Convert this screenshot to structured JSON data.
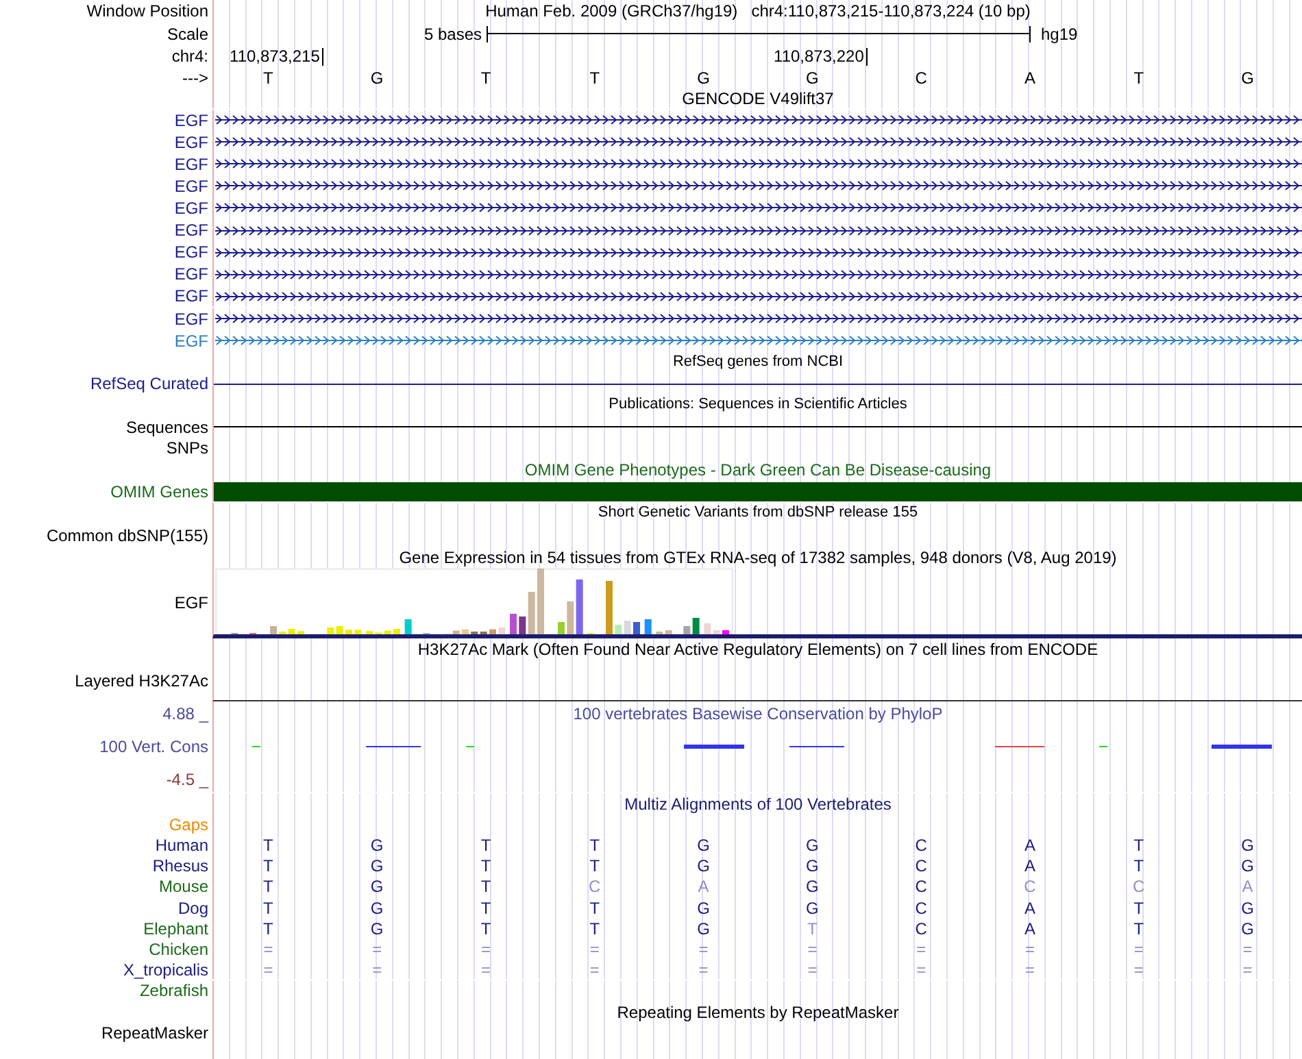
{
  "header": {
    "label": "Window Position",
    "assembly": "Human Feb. 2009 (GRCh37/hg19)",
    "position": "chr4:110,873,215-110,873,224 (10 bp)"
  },
  "scale": {
    "label": "Scale",
    "length": "5 bases",
    "assembly": "hg19"
  },
  "ruler": {
    "label": "chr4:",
    "ticks": [
      "110,873,215",
      "110,873,220"
    ]
  },
  "bases": {
    "label": "--->",
    "letters": [
      "T",
      "G",
      "T",
      "T",
      "G",
      "G",
      "C",
      "A",
      "T",
      "G"
    ]
  },
  "gencode": {
    "title": "GENCODE V49lift37",
    "transcripts": [
      {
        "label": "EGF",
        "color": "#1c1c8c"
      },
      {
        "label": "EGF",
        "color": "#1c1c8c"
      },
      {
        "label": "EGF",
        "color": "#1c1c8c"
      },
      {
        "label": "EGF",
        "color": "#1c1c8c"
      },
      {
        "label": "EGF",
        "color": "#1c1c8c"
      },
      {
        "label": "EGF",
        "color": "#1c1c8c"
      },
      {
        "label": "EGF",
        "color": "#1c1c8c"
      },
      {
        "label": "EGF",
        "color": "#1c1c8c"
      },
      {
        "label": "EGF",
        "color": "#1c1c8c"
      },
      {
        "label": "EGF",
        "color": "#1c1c8c"
      },
      {
        "label": "EGF",
        "color": "#2a7fc0"
      }
    ]
  },
  "refseq": {
    "title": "RefSeq genes from NCBI",
    "label": "RefSeq Curated"
  },
  "publications": {
    "title": "Publications: Sequences in Scientific Articles",
    "label": "Sequences"
  },
  "snps": {
    "label": "SNPs"
  },
  "omim": {
    "title": "OMIM Gene Phenotypes - Dark Green Can Be Disease-causing",
    "label": "OMIM Genes"
  },
  "dbsnp": {
    "title": "Short Genetic Variants from dbSNP release 155",
    "label": "Common dbSNP(155)"
  },
  "gtex": {
    "title": "Gene Expression in 54 tissues from GTEx RNA-seq of 17382 samples, 948 donors (V8, Aug 2019)",
    "label": "EGF"
  },
  "h3k27ac": {
    "title": "H3K27Ac Mark (Often Found Near Active Regulatory Elements) on 7 cell lines from ENCODE",
    "label": "Layered H3K27Ac"
  },
  "conservation": {
    "title": "100 vertebrates Basewise Conservation by PhyloP",
    "label": "100 Vert. Cons",
    "max": "4.88 _",
    "min": "-4.5 _"
  },
  "multiz": {
    "title": "Multiz Alignments of 100 Vertebrates",
    "gaps_label": "Gaps",
    "species": [
      {
        "name": "Human",
        "color": "#1c1c7c",
        "bases": [
          {
            "b": "T",
            "faded": false
          },
          {
            "b": "G",
            "faded": false
          },
          {
            "b": "T",
            "faded": false
          },
          {
            "b": "T",
            "faded": false
          },
          {
            "b": "G",
            "faded": false
          },
          {
            "b": "G",
            "faded": false
          },
          {
            "b": "C",
            "faded": false
          },
          {
            "b": "A",
            "faded": false
          },
          {
            "b": "T",
            "faded": false
          },
          {
            "b": "G",
            "faded": false
          }
        ]
      },
      {
        "name": "Rhesus",
        "color": "#1c1c7c",
        "bases": [
          {
            "b": "T",
            "faded": false
          },
          {
            "b": "G",
            "faded": false
          },
          {
            "b": "T",
            "faded": false
          },
          {
            "b": "T",
            "faded": false
          },
          {
            "b": "G",
            "faded": false
          },
          {
            "b": "G",
            "faded": false
          },
          {
            "b": "C",
            "faded": false
          },
          {
            "b": "A",
            "faded": false
          },
          {
            "b": "T",
            "faded": false
          },
          {
            "b": "G",
            "faded": false
          }
        ]
      },
      {
        "name": "Mouse",
        "color": "#1a6b1a",
        "bases": [
          {
            "b": "T",
            "faded": false
          },
          {
            "b": "G",
            "faded": false
          },
          {
            "b": "T",
            "faded": false
          },
          {
            "b": "C",
            "faded": true
          },
          {
            "b": "A",
            "faded": true
          },
          {
            "b": "G",
            "faded": false
          },
          {
            "b": "C",
            "faded": false
          },
          {
            "b": "C",
            "faded": true
          },
          {
            "b": "C",
            "faded": true
          },
          {
            "b": "A",
            "faded": true
          }
        ]
      },
      {
        "name": "Dog",
        "color": "#1c1c7c",
        "bases": [
          {
            "b": "T",
            "faded": false
          },
          {
            "b": "G",
            "faded": false
          },
          {
            "b": "T",
            "faded": false
          },
          {
            "b": "T",
            "faded": false
          },
          {
            "b": "G",
            "faded": false
          },
          {
            "b": "G",
            "faded": false
          },
          {
            "b": "C",
            "faded": false
          },
          {
            "b": "A",
            "faded": false
          },
          {
            "b": "T",
            "faded": false
          },
          {
            "b": "G",
            "faded": false
          }
        ]
      },
      {
        "name": "Elephant",
        "color": "#1a6b1a",
        "bases": [
          {
            "b": "T",
            "faded": false
          },
          {
            "b": "G",
            "faded": false
          },
          {
            "b": "T",
            "faded": false
          },
          {
            "b": "T",
            "faded": false
          },
          {
            "b": "G",
            "faded": false
          },
          {
            "b": "T",
            "faded": true
          },
          {
            "b": "C",
            "faded": false
          },
          {
            "b": "A",
            "faded": false
          },
          {
            "b": "T",
            "faded": false
          },
          {
            "b": "G",
            "faded": false
          }
        ]
      },
      {
        "name": "Chicken",
        "color": "#1a6b1a",
        "bases": [
          {
            "b": "=",
            "faded": true
          },
          {
            "b": "=",
            "faded": true
          },
          {
            "b": "=",
            "faded": true
          },
          {
            "b": "=",
            "faded": true
          },
          {
            "b": "=",
            "faded": true
          },
          {
            "b": "=",
            "faded": true
          },
          {
            "b": "=",
            "faded": true
          },
          {
            "b": "=",
            "faded": true
          },
          {
            "b": "=",
            "faded": true
          },
          {
            "b": "=",
            "faded": true
          }
        ]
      },
      {
        "name": "X_tropicalis",
        "color": "#1c1c7c",
        "bases": [
          {
            "b": "=",
            "faded": true
          },
          {
            "b": "=",
            "faded": true
          },
          {
            "b": "=",
            "faded": true
          },
          {
            "b": "=",
            "faded": true
          },
          {
            "b": "=",
            "faded": true
          },
          {
            "b": "=",
            "faded": true
          },
          {
            "b": "=",
            "faded": true
          },
          {
            "b": "=",
            "faded": true
          },
          {
            "b": "=",
            "faded": true
          },
          {
            "b": "=",
            "faded": true
          }
        ]
      },
      {
        "name": "Zebrafish",
        "color": "#1a6b1a"
      }
    ]
  },
  "repeatmasker": {
    "title": "Repeating Elements by RepeatMasker",
    "label": "RepeatMasker"
  }
}
